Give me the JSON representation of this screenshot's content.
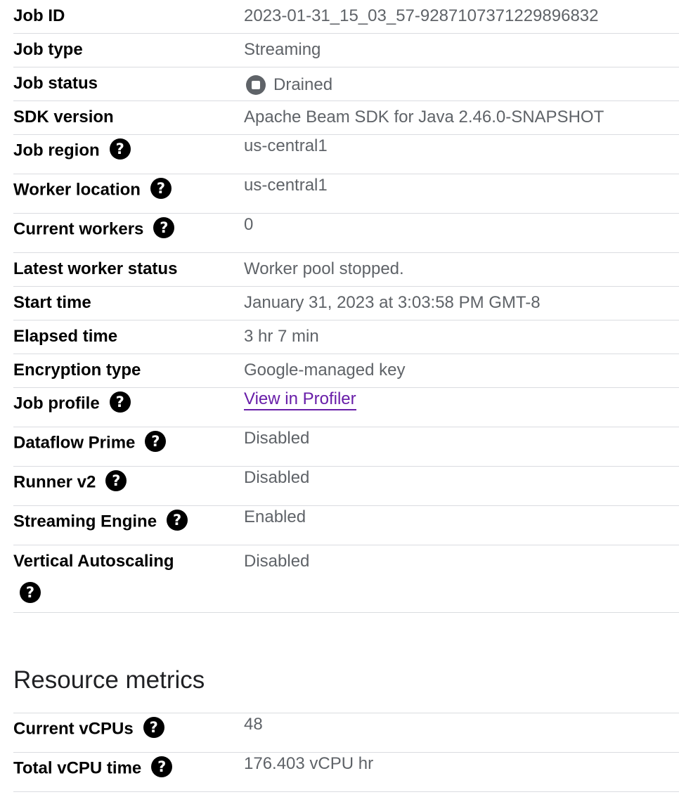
{
  "job_info": {
    "rows": [
      {
        "label": "Job ID",
        "value": "2023-01-31_15_03_57-9287107371229896832"
      },
      {
        "label": "Job type",
        "value": "Streaming"
      },
      {
        "label": "Job status",
        "value": "Drained"
      },
      {
        "label": "SDK version",
        "value": "Apache Beam SDK for Java 2.46.0-SNAPSHOT"
      },
      {
        "label": "Job region",
        "value": "us-central1"
      },
      {
        "label": "Worker location",
        "value": "us-central1"
      },
      {
        "label": "Current workers",
        "value": "0"
      },
      {
        "label": "Latest worker status",
        "value": "Worker pool stopped."
      },
      {
        "label": "Start time",
        "value": "January 31, 2023 at 3:03:58 PM GMT-8"
      },
      {
        "label": "Elapsed time",
        "value": "3 hr 7 min"
      },
      {
        "label": "Encryption type",
        "value": "Google-managed key"
      },
      {
        "label": "Job profile",
        "value": "View in Profiler"
      },
      {
        "label": "Dataflow Prime",
        "value": "Disabled"
      },
      {
        "label": "Runner v2",
        "value": "Disabled"
      },
      {
        "label": "Streaming Engine",
        "value": "Enabled"
      },
      {
        "label": "Vertical Autoscaling",
        "value": "Disabled"
      }
    ]
  },
  "resource_metrics": {
    "title": "Resource metrics",
    "rows": [
      {
        "label": "Current vCPUs",
        "value": "48"
      },
      {
        "label": "Total vCPU time",
        "value": "176.403 vCPU hr"
      }
    ]
  },
  "icons": {
    "help": "?",
    "help_icon_name": "help-circle-icon",
    "status_icon_name": "drained-stop-icon"
  },
  "colors": {
    "label": "#000000",
    "value": "#5f6368",
    "link": "#681da8",
    "divider": "#dadce0",
    "status_icon": "#5f6368"
  }
}
